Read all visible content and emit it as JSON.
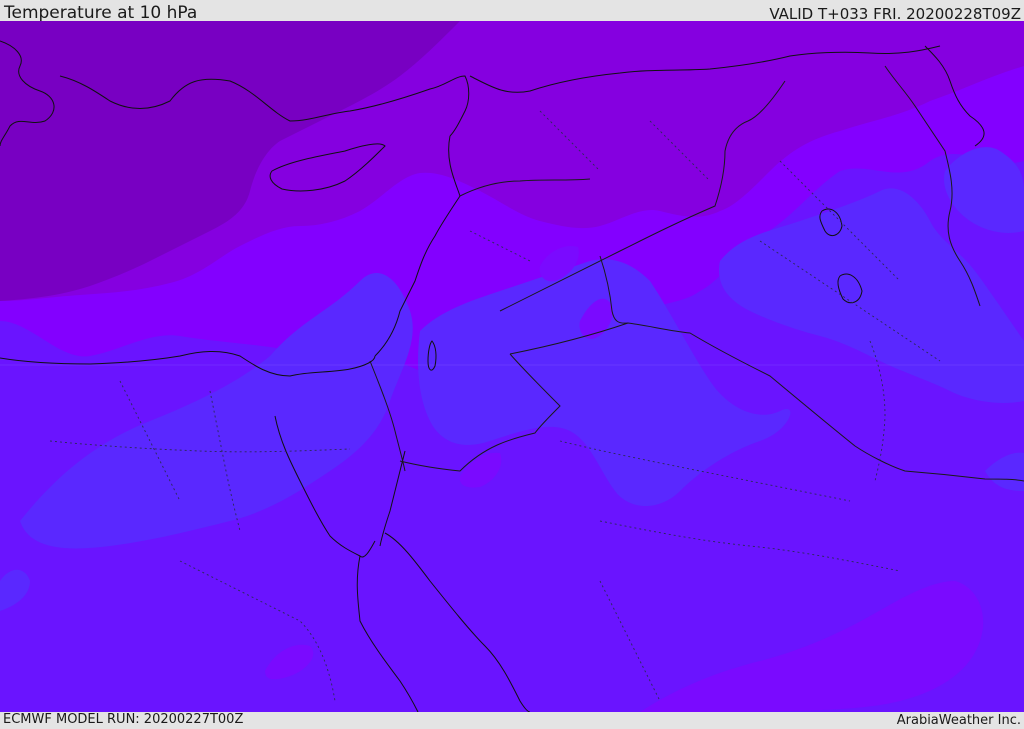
{
  "header": {
    "title": "Temperature at 10 hPa",
    "valid": "VALID T+033 FRI. 20200228T09Z"
  },
  "footer": {
    "model_run": "ECMWF MODEL RUN: 20200227T00Z",
    "credit": "ArabiaWeather Inc."
  },
  "map": {
    "field": "temperature",
    "level": "10 hPa",
    "colors": {
      "deep_violet": "#7800c2",
      "violet": "#8500e0",
      "purple": "#8300ff",
      "blue_violet": "#6a14ff",
      "indigo_blue": "#5a28ff",
      "coast": "#111111",
      "border": "#1a1a1a",
      "admin_border": "#2a2a55"
    }
  }
}
